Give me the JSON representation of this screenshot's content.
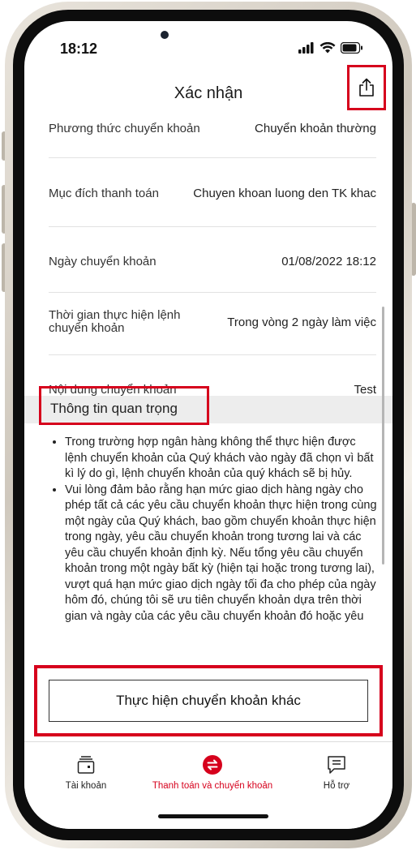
{
  "status": {
    "time": "18:12"
  },
  "header": {
    "title": "Xác nhận"
  },
  "details": [
    {
      "label": "Phương thức chuyển khoản",
      "value": "Chuyển khoản thường"
    },
    {
      "label": "Mục đích thanh toán",
      "value": "Chuyen khoan luong den TK khac"
    },
    {
      "label": "Ngày chuyển khoản",
      "value": "01/08/2022 18:12"
    },
    {
      "label_line1": "Thời gian thực hiện lệnh",
      "label_line2": "chuyển khoản",
      "value": "Trong vòng 2 ngày làm việc"
    },
    {
      "label": "Nội dung chuyển khoản",
      "value": "Test"
    }
  ],
  "important": {
    "title": "Thông tin quan trọng",
    "bullets": [
      "Trong trường hợp ngân hàng không thể thực hiện được lệnh chuyển khoản của Quý khách vào ngày đã chọn vì bất kì lý do gì, lệnh chuyển khoản của quý khách sẽ bị hủy.",
      "Vui lòng đảm bảo rằng hạn mức giao dịch hàng ngày cho phép tất cả các yêu cầu chuyển khoản thực hiện trong cùng một ngày của Quý khách, bao gồm chuyển khoản thực hiện trong ngày, yêu cầu chuyển khoản trong tương lai và các yêu cầu chuyển khoản định kỳ. Nếu tổng yêu cầu chuyển khoản trong một ngày bất kỳ (hiện tại hoặc trong tương lai), vượt quá hạn mức giao dịch ngày tối đa cho phép của ngày hôm đó, chúng tôi sẽ ưu tiên chuyển khoản dựa trên thời gian và ngày của các yêu cầu chuyển khoản đó hoặc yêu"
    ]
  },
  "action": {
    "label": "Thực hiện chuyển khoản khác"
  },
  "tabs": [
    {
      "label": "Tài khoản",
      "icon": "wallet-icon",
      "active": false
    },
    {
      "label": "Thanh toán và chuyển khoản",
      "icon": "transfer-icon",
      "active": true
    },
    {
      "label": "Hỗ trợ",
      "icon": "chat-icon",
      "active": false
    }
  ],
  "colors": {
    "accent": "#d6001c",
    "highlight": "#d6001c",
    "text": "#222222"
  }
}
